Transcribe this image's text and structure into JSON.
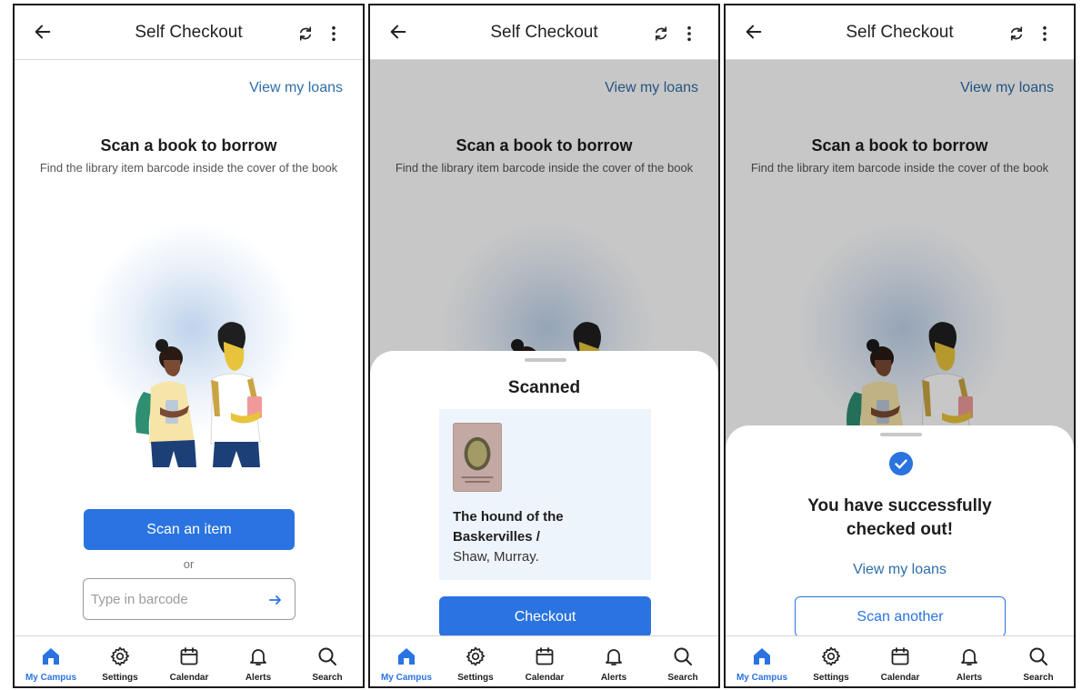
{
  "app": {
    "title": "Self Checkout",
    "view_loans_label": "View my loans",
    "heading": "Scan a book to borrow",
    "subheading": "Find the library item barcode inside the cover of the book"
  },
  "screen1": {
    "scan_button_label": "Scan an item",
    "or_label": "or",
    "barcode_placeholder": "Type in barcode"
  },
  "screen2": {
    "sheet_title": "Scanned",
    "book_title": "The hound of the Baskervilles /",
    "book_author": "Shaw, Murray.",
    "checkout_label": "Checkout"
  },
  "screen3": {
    "success_line1": "You have successfully",
    "success_line2": "checked out!",
    "view_loans_label": "View my loans",
    "scan_another_label": "Scan another"
  },
  "nav": {
    "items": [
      {
        "label": "My Campus",
        "icon": "home-icon"
      },
      {
        "label": "Settings",
        "icon": "gear-icon"
      },
      {
        "label": "Calendar",
        "icon": "calendar-icon"
      },
      {
        "label": "Alerts",
        "icon": "bell-icon"
      },
      {
        "label": "Search",
        "icon": "search-icon"
      }
    ],
    "active_index": 0
  },
  "colors": {
    "accent": "#2a73e0",
    "link": "#2e6ea8",
    "card_background": "#eef4fb"
  }
}
